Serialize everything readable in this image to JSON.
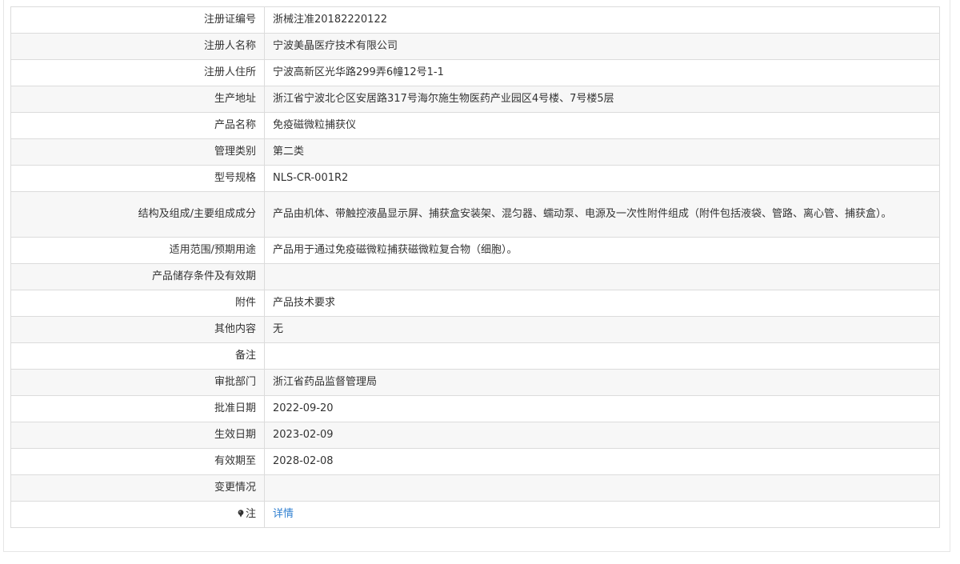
{
  "rows": [
    {
      "label": "注册证编号",
      "value": "浙械注准20182220122"
    },
    {
      "label": "注册人名称",
      "value": "宁波美晶医疗技术有限公司"
    },
    {
      "label": "注册人住所",
      "value": "宁波高新区光华路299弄6幢12号1-1"
    },
    {
      "label": "生产地址",
      "value": "浙江省宁波北仑区安居路317号海尔施生物医药产业园区4号楼、7号楼5层"
    },
    {
      "label": "产品名称",
      "value": "免疫磁微粒捕获仪"
    },
    {
      "label": "管理类别",
      "value": "第二类"
    },
    {
      "label": "型号规格",
      "value": "NLS-CR-001R2"
    },
    {
      "label": "结构及组成/主要组成成分",
      "value": "产品由机体、带触控液晶显示屏、捕获盒安装架、混匀器、蠕动泵、电源及一次性附件组成（附件包括液袋、管路、离心管、捕获盒）。"
    },
    {
      "label": "适用范围/预期用途",
      "value": "产品用于通过免疫磁微粒捕获磁微粒复合物（细胞）。"
    },
    {
      "label": "产品储存条件及有效期",
      "value": ""
    },
    {
      "label": "附件",
      "value": "产品技术要求"
    },
    {
      "label": "其他内容",
      "value": "无"
    },
    {
      "label": "备注",
      "value": ""
    },
    {
      "label": "审批部门",
      "value": "浙江省药品监督管理局"
    },
    {
      "label": "批准日期",
      "value": "2022-09-20"
    },
    {
      "label": "生效日期",
      "value": "2023-02-09"
    },
    {
      "label": "有效期至",
      "value": "2028-02-08"
    },
    {
      "label": "变更情况",
      "value": ""
    },
    {
      "label": "注",
      "value": "详情",
      "icon": "pin-icon"
    }
  ]
}
